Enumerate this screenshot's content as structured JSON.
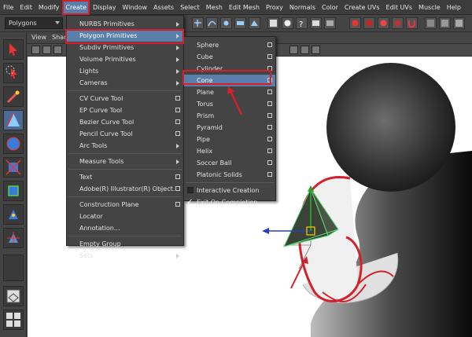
{
  "menubar": {
    "items": [
      "File",
      "Edit",
      "Modify",
      "Create",
      "Display",
      "Window",
      "Assets",
      "Select",
      "Mesh",
      "Edit Mesh",
      "Proxy",
      "Normals",
      "Color",
      "Create UVs",
      "Edit UVs",
      "Muscle",
      "Help"
    ],
    "active_index": 3
  },
  "status": {
    "mode": "Polygons"
  },
  "panel": {
    "view_label": "View",
    "shading_label": "Shac"
  },
  "create_menu": {
    "items": [
      {
        "label": "NURBS Primitives",
        "kind": "sub"
      },
      {
        "label": "Polygon Primitives",
        "kind": "sub",
        "highlight": true
      },
      {
        "label": "Subdiv Primitives",
        "kind": "sub"
      },
      {
        "label": "Volume Primitives",
        "kind": "sub"
      },
      {
        "label": "Lights",
        "kind": "sub"
      },
      {
        "label": "Cameras",
        "kind": "sub"
      },
      {
        "label": "CV Curve Tool",
        "kind": "opt"
      },
      {
        "label": "EP Curve Tool",
        "kind": "opt"
      },
      {
        "label": "Bezier Curve Tool",
        "kind": "opt"
      },
      {
        "label": "Pencil Curve Tool",
        "kind": "opt"
      },
      {
        "label": "Arc Tools",
        "kind": "sub"
      },
      {
        "label": "Measure Tools",
        "kind": "sub"
      },
      {
        "label": "Text",
        "kind": "opt"
      },
      {
        "label": "Adobe(R) Illustrator(R) Object...",
        "kind": "opt"
      },
      {
        "label": "Construction Plane",
        "kind": "opt"
      },
      {
        "label": "Locator",
        "kind": "none"
      },
      {
        "label": "Annotation...",
        "kind": "none"
      },
      {
        "label": "Empty Group",
        "kind": "none"
      },
      {
        "label": "Sets",
        "kind": "sub"
      }
    ]
  },
  "poly_menu": {
    "items": [
      {
        "label": "Sphere"
      },
      {
        "label": "Cube"
      },
      {
        "label": "Cylinder"
      },
      {
        "label": "Cone",
        "highlight": true
      },
      {
        "label": "Plane"
      },
      {
        "label": "Torus"
      },
      {
        "label": "Prism"
      },
      {
        "label": "Pyramid"
      },
      {
        "label": "Pipe"
      },
      {
        "label": "Helix"
      },
      {
        "label": "Soccer Ball"
      },
      {
        "label": "Platonic Solids"
      }
    ],
    "interactive_creation": "Interactive Creation",
    "exit_on_completion": "Exit On Completion"
  },
  "colors": {
    "highlight": "#5a7faa",
    "annotation_red": "#d4202a"
  }
}
